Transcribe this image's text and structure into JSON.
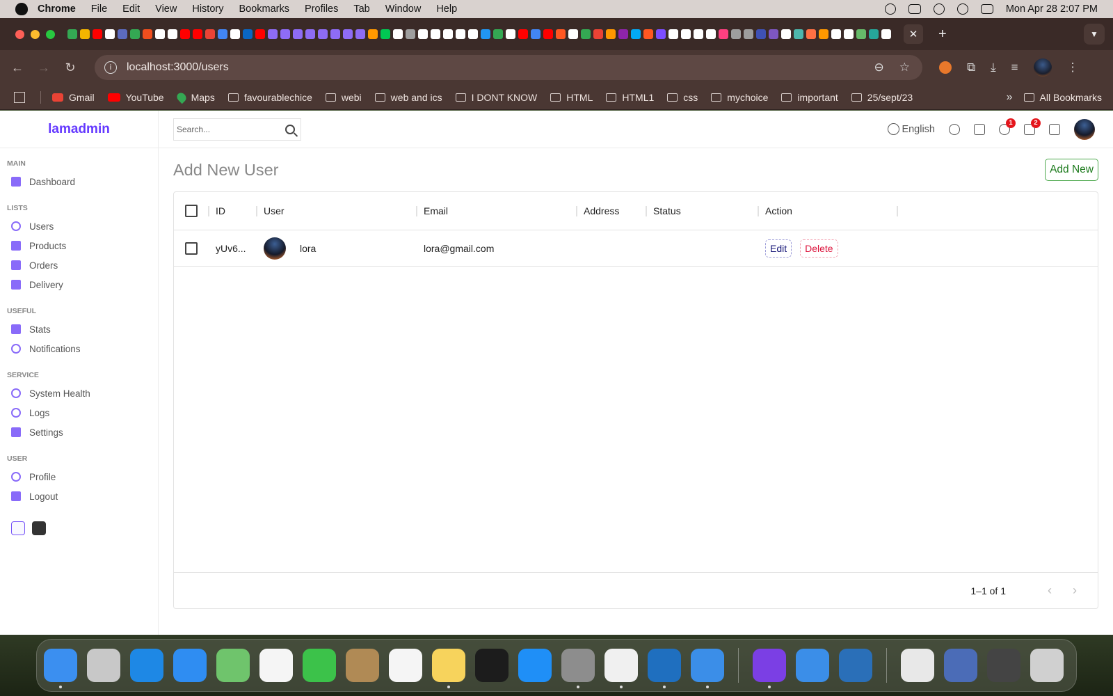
{
  "menubar": {
    "app": "Chrome",
    "items": [
      "File",
      "Edit",
      "View",
      "History",
      "Bookmarks",
      "Profiles",
      "Tab",
      "Window",
      "Help"
    ],
    "clock": "Mon Apr 28  2:07 PM"
  },
  "browser": {
    "url": "localhost:3000/users",
    "tab_close": "✕",
    "tab_new": "+",
    "favicon_colors": [
      "#34a853",
      "#f4b400",
      "#ff0000",
      "#ffffff",
      "#5c6bc0",
      "#34a853",
      "#f24e1e",
      "#ffffff",
      "#ffffff",
      "#ff0000",
      "#ff0000",
      "#ea4335",
      "#4285f4",
      "#ffffff",
      "#0a66c2",
      "#ff0000",
      "#8e6cf5",
      "#8e6cf5",
      "#8e6cf5",
      "#8e6cf5",
      "#8e6cf5",
      "#8e6cf5",
      "#8e6cf5",
      "#8e6cf5",
      "#ff9800",
      "#00c853",
      "#ffffff",
      "#9e9e9e",
      "#ffffff",
      "#ffffff",
      "#ffffff",
      "#ffffff",
      "#ffffff",
      "#2196f3",
      "#34a853",
      "#ffffff",
      "#ff0000",
      "#4285f4",
      "#ff0000",
      "#ff5722",
      "#ffffff",
      "#34a853",
      "#ea4335",
      "#ff9800",
      "#8e24aa",
      "#03a9f4",
      "#ff5722",
      "#7c4dff",
      "#ffffff",
      "#ffffff",
      "#ffffff",
      "#ffffff",
      "#ff4081",
      "#9e9e9e",
      "#9e9e9e",
      "#3f51b5",
      "#7e57c2",
      "#ffffff",
      "#4db6ac",
      "#ff7043",
      "#ff9800",
      "#ffffff",
      "#ffffff",
      "#66bb6a",
      "#26a69a",
      "#ffffff"
    ]
  },
  "bookmarks": {
    "items": [
      {
        "label": "Gmail",
        "icon": "gmail-icon"
      },
      {
        "label": "YouTube",
        "icon": "youtube-icon"
      },
      {
        "label": "Maps",
        "icon": "maps-icon"
      },
      {
        "label": "favourablechice",
        "icon": "folder-icon"
      },
      {
        "label": "webi",
        "icon": "folder-icon"
      },
      {
        "label": "web and ics",
        "icon": "folder-icon"
      },
      {
        "label": "I DONT KNOW",
        "icon": "folder-icon"
      },
      {
        "label": "HTML",
        "icon": "folder-icon"
      },
      {
        "label": "HTML1",
        "icon": "folder-icon"
      },
      {
        "label": "css",
        "icon": "folder-icon"
      },
      {
        "label": "mychoice",
        "icon": "folder-icon"
      },
      {
        "label": "important",
        "icon": "folder-icon"
      },
      {
        "label": "25/sept/23",
        "icon": "folder-icon"
      }
    ],
    "more": "»",
    "all": "All Bookmarks"
  },
  "sidebar": {
    "logo": "lamadmin",
    "sections": [
      {
        "title": "MAIN",
        "items": [
          {
            "label": "Dashboard",
            "icon": "dashboard-icon"
          }
        ]
      },
      {
        "title": "LISTS",
        "items": [
          {
            "label": "Users",
            "icon": "user-icon"
          },
          {
            "label": "Products",
            "icon": "store-icon"
          },
          {
            "label": "Orders",
            "icon": "credit-card-icon"
          },
          {
            "label": "Delivery",
            "icon": "truck-icon"
          }
        ]
      },
      {
        "title": "USEFUL",
        "items": [
          {
            "label": "Stats",
            "icon": "chart-icon"
          },
          {
            "label": "Notifications",
            "icon": "bell-icon"
          }
        ]
      },
      {
        "title": "SERVICE",
        "items": [
          {
            "label": "System Health",
            "icon": "health-icon"
          },
          {
            "label": "Logs",
            "icon": "psychology-icon"
          },
          {
            "label": "Settings",
            "icon": "settings-icon"
          }
        ]
      },
      {
        "title": "USER",
        "items": [
          {
            "label": "Profile",
            "icon": "account-icon"
          },
          {
            "label": "Logout",
            "icon": "logout-icon"
          }
        ]
      }
    ]
  },
  "topnav": {
    "search_placeholder": "Search...",
    "language": "English",
    "notifications_count": "1",
    "messages_count": "2"
  },
  "main": {
    "title": "Add New User",
    "add_button": "Add New",
    "columns": [
      "ID",
      "User",
      "Email",
      "Address",
      "Status",
      "Action"
    ],
    "rows": [
      {
        "id": "yUv6...",
        "user": "lora",
        "email": "lora@gmail.com",
        "address": "",
        "status": "",
        "edit": "Edit",
        "delete": "Delete"
      }
    ],
    "pagination": "1–1 of 1",
    "prev": "‹",
    "next": "›"
  },
  "dock": {
    "apps": [
      {
        "name": "finder",
        "color": "#3b8ff0",
        "running": true
      },
      {
        "name": "launchpad",
        "color": "#c8c8c8",
        "running": false
      },
      {
        "name": "safari",
        "color": "#1e88e5",
        "running": false
      },
      {
        "name": "mail",
        "color": "#2f8df2",
        "running": false
      },
      {
        "name": "maps",
        "color": "#6fc46c",
        "running": false
      },
      {
        "name": "photos",
        "color": "#f5f5f5",
        "running": false
      },
      {
        "name": "facetime",
        "color": "#3cc24a",
        "running": false
      },
      {
        "name": "contacts",
        "color": "#b08a55",
        "running": false
      },
      {
        "name": "reminders",
        "color": "#f5f5f5",
        "running": false
      },
      {
        "name": "notes",
        "color": "#f7d35c",
        "running": true
      },
      {
        "name": "apple-tv",
        "color": "#1c1c1c",
        "running": false
      },
      {
        "name": "app-store",
        "color": "#1f8ff7",
        "running": false
      },
      {
        "name": "system-settings",
        "color": "#8d8d8d",
        "running": true
      },
      {
        "name": "chrome",
        "color": "#f0f0f0",
        "running": true
      },
      {
        "name": "vscode",
        "color": "#1f6fbf",
        "running": true
      },
      {
        "name": "xcode",
        "color": "#3b8ee8",
        "running": true
      },
      {
        "name": "github-desktop",
        "color": "#7b3fe4",
        "running": true
      },
      {
        "name": "simulator",
        "color": "#3b8ee8",
        "running": false
      },
      {
        "name": "quicktime",
        "color": "#2a6fb8",
        "running": false
      },
      {
        "name": "window-thumb-1",
        "color": "#e8e8e8",
        "running": false
      },
      {
        "name": "window-thumb-2",
        "color": "#4b6cb7",
        "running": false
      },
      {
        "name": "window-thumb-3",
        "color": "#444444",
        "running": false
      },
      {
        "name": "trash",
        "color": "#d0d0d0",
        "running": false
      }
    ]
  }
}
